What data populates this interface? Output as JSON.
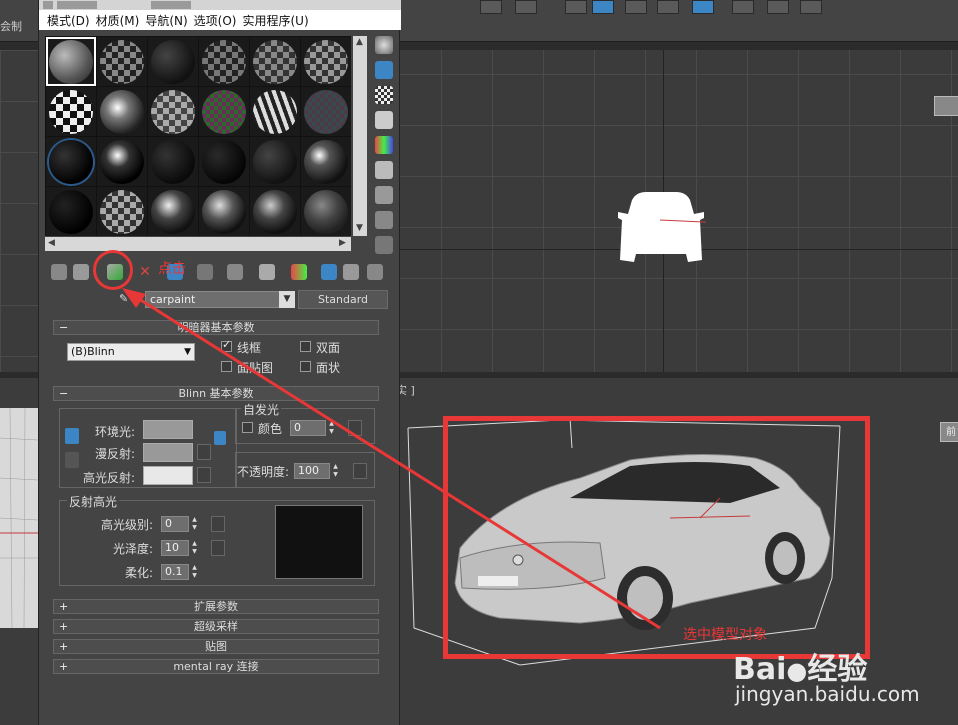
{
  "app": {
    "left_label": "会制"
  },
  "menu": {
    "items": [
      "模式(D)",
      "材质(M)",
      "导航(N)",
      "选项(O)",
      "实用程序(U)"
    ]
  },
  "material": {
    "name": "carpaint",
    "type_button": "Standard"
  },
  "shader_rollout": {
    "title": "明暗器基本参数",
    "shader": "(B)Blinn",
    "wire_label": "线框",
    "two_sided_label": "双面",
    "face_map_label": "面贴图",
    "faceted_label": "面状"
  },
  "blinn_rollout": {
    "title": "Blinn 基本参数",
    "self_illum_group": "自发光",
    "color_label": "颜色",
    "color_value": "0",
    "ambient_label": "环境光:",
    "diffuse_label": "漫反射:",
    "specular_label": "高光反射:",
    "opacity_label": "不透明度:",
    "opacity_value": "100",
    "spec_group": "反射高光",
    "spec_level_label": "高光级别:",
    "spec_level_value": "0",
    "gloss_label": "光泽度:",
    "gloss_value": "10",
    "soften_label": "柔化:",
    "soften_value": "0.1"
  },
  "collapsed_rollouts": [
    "扩展参数",
    "超级采样",
    "贴图",
    "mental ray 连接"
  ],
  "viewports": {
    "top_label": "]",
    "persp_label": "实 ]",
    "cube_front": "前"
  },
  "annotations": {
    "click_note": "点击",
    "select_note": "选中模型对象"
  },
  "watermark": {
    "logo_text": "Bai",
    "logo_text2": "经验",
    "url": "jingyan.baidu.com"
  },
  "colors": {
    "annotation_red": "#e83737",
    "accent_blue": "#3d86c6"
  }
}
